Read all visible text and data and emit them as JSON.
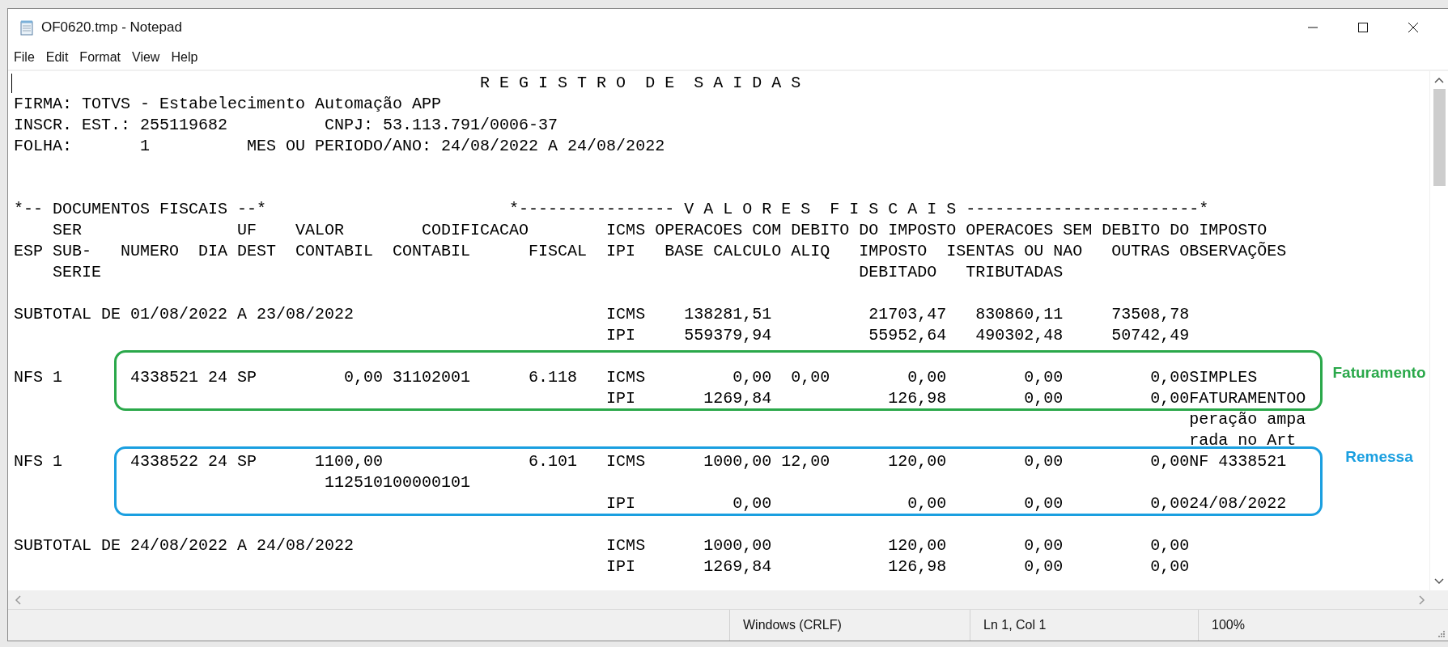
{
  "window": {
    "title": "OF0620.tmp - Notepad"
  },
  "menu": [
    "File",
    "Edit",
    "Format",
    "View",
    "Help"
  ],
  "document": {
    "blocks": [
      {
        "lines": [
          "                                                R E G I S T R O  D E  S A I D A S",
          "FIRMA: TOTVS - Estabelecimento Automação APP",
          "INSCR. EST.: 255119682          CNPJ: 53.113.791/0006-37",
          "FOLHA:       1          MES OU PERIODO/ANO: 24/08/2022 A 24/08/2022"
        ]
      },
      {
        "lines": [
          "*-- DOCUMENTOS FISCAIS --*                         *---------------- V A L O R E S  F I S C A I S ------------------------*",
          "    SER                UF    VALOR        CODIFICACAO        ICMS OPERACOES COM DEBITO DO IMPOSTO OPERACOES SEM DEBITO DO IMPOSTO",
          "ESP SUB-   NUMERO  DIA DEST  CONTABIL  CONTABIL      FISCAL  IPI   BASE CALCULO ALIQ   IMPOSTO  ISENTAS OU NAO   OUTRAS OBSERVAÇÕES",
          "    SERIE                                                                              DEBITADO   TRIBUTADAS"
        ]
      },
      {
        "lines": [
          "SUBTOTAL DE 01/08/2022 A 23/08/2022                          ICMS    138281,51          21703,47   830860,11     73508,78",
          "                                                             IPI     559379,94          55952,64   490302,48     50742,49"
        ]
      },
      {
        "lines": [
          "NFS 1       4338521 24 SP         0,00 31102001      6.118   ICMS         0,00  0,00        0,00        0,00         0,00SIMPLES",
          "                                                             IPI       1269,84            126,98        0,00         0,00FATURAMENTOO"
        ],
        "annotation": {
          "label": "Faturamento",
          "color": "#2aa84a"
        }
      },
      {
        "lines": [
          "                                                                                                                         peração ampa",
          "                                                                                                                         rada no Art"
        ]
      },
      {
        "lines": [
          "NFS 1       4338522 24 SP      1100,00               6.101   ICMS      1000,00 12,00      120,00        0,00         0,00NF 4338521",
          "                                112510100000101",
          "                                                             IPI          0,00              0,00        0,00         0,0024/08/2022"
        ],
        "annotation": {
          "label": "Remessa",
          "color": "#1a9fe0"
        }
      },
      {
        "lines": [
          "SUBTOTAL DE 24/08/2022 A 24/08/2022                          ICMS      1000,00            120,00        0,00         0,00",
          "                                                             IPI       1269,84            126,98        0,00         0,00"
        ]
      }
    ]
  },
  "status_bar": [
    "Windows (CRLF)",
    "Ln 1, Col 1",
    "100%"
  ]
}
